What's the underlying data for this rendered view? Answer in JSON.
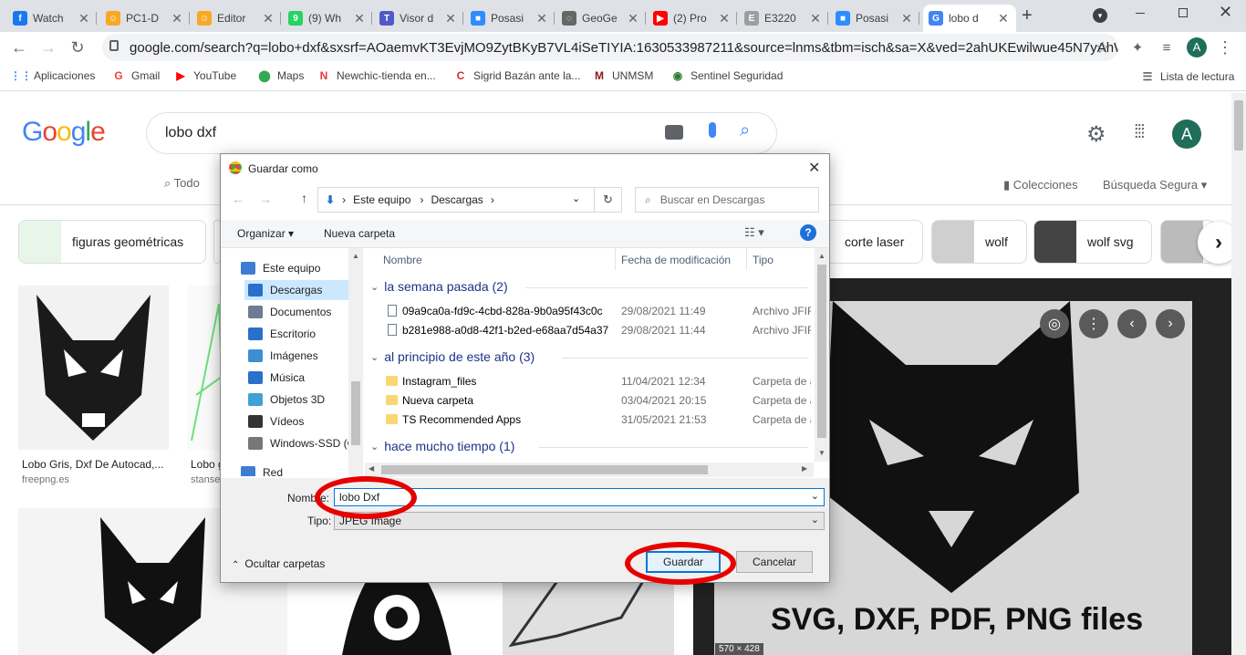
{
  "browser": {
    "tabs": [
      {
        "title": "Watch",
        "favicon": "facebook-icon",
        "color": "#1877f2",
        "glyph": "f"
      },
      {
        "title": "PC1-D",
        "favicon": "emoji-icon",
        "color": "#f9a825",
        "glyph": "☺"
      },
      {
        "title": "Editor",
        "favicon": "emoji-icon",
        "color": "#f9a825",
        "glyph": "☺"
      },
      {
        "title": "(9) Wh",
        "favicon": "whatsapp-icon",
        "color": "#25d366",
        "glyph": "9"
      },
      {
        "title": "Visor d",
        "favicon": "teams-icon",
        "color": "#5059c9",
        "glyph": "T"
      },
      {
        "title": "Posasi",
        "favicon": "zoom-icon",
        "color": "#2d8cff",
        "glyph": "■"
      },
      {
        "title": "GeoGe",
        "favicon": "geogebra-icon",
        "color": "#666666",
        "glyph": "◌"
      },
      {
        "title": "(2) Pro",
        "favicon": "youtube-icon",
        "color": "#ff0000",
        "glyph": "▶"
      },
      {
        "title": "E3220",
        "favicon": "document-icon",
        "color": "#9e9e9e",
        "glyph": "E"
      },
      {
        "title": "Posasi",
        "favicon": "zoom-icon",
        "color": "#2d8cff",
        "glyph": "■"
      },
      {
        "title": "lobo d",
        "favicon": "google-icon",
        "color": "#4285f4",
        "glyph": "G"
      }
    ],
    "url": "google.com/search?q=lobo+dxf&sxsrf=AOaemvKT3EvjMO9ZytBKyB7VL4iSeTIYIA:1630533987211&source=lnms&tbm=isch&sa=X&ved=2ahUKEwilwue45N7yAhWzr5...",
    "profile_initial": "A",
    "bookmarks": [
      {
        "label": "Aplicaciones",
        "icon": "apps-grid-icon",
        "color": "#4285f4",
        "glyph": "⋮⋮"
      },
      {
        "label": "Gmail",
        "icon": "google-icon",
        "color": "#ea4335",
        "glyph": "G"
      },
      {
        "label": "YouTube",
        "icon": "youtube-icon",
        "color": "#ff0000",
        "glyph": "▶"
      },
      {
        "label": "Maps",
        "icon": "maps-pin-icon",
        "color": "#34a853",
        "glyph": "⬤"
      },
      {
        "label": "Newchic-tienda en...",
        "icon": "newchic-icon",
        "color": "#e53935",
        "glyph": "N"
      },
      {
        "label": "Sigrid Bazán ante la...",
        "icon": "c-logo-icon",
        "color": "#d32f2f",
        "glyph": "C"
      },
      {
        "label": "UNMSM",
        "icon": "unmsm-icon",
        "color": "#8b1a1a",
        "glyph": "M"
      },
      {
        "label": "Sentinel Seguridad",
        "icon": "eye-icon",
        "color": "#2e7d32",
        "glyph": "◉"
      }
    ],
    "reading_list": "Lista de lectura"
  },
  "google": {
    "logo": "Google",
    "query": "lobo dxf",
    "profile_initial": "A",
    "tabs": {
      "all": "Todo"
    },
    "collections": "Colecciones",
    "safe_search": "Búsqueda Segura",
    "chips": [
      "figuras geométricas",
      "corte laser",
      "wolf",
      "wolf svg"
    ],
    "results": [
      {
        "caption": "Lobo Gris, Dxf De Autocad,...",
        "source": "freepng.es"
      },
      {
        "caption": "Lobo g",
        "source": "stanse"
      }
    ],
    "preview": {
      "text": "SVG, DXF, PDF, PNG files",
      "size": "570 × 428"
    }
  },
  "dialog": {
    "title": "Guardar como",
    "path": [
      "Este equipo",
      "Descargas"
    ],
    "search_placeholder": "Buscar en Descargas",
    "organize": "Organizar",
    "new_folder": "Nueva carpeta",
    "nav_items": [
      {
        "label": "Este equipo",
        "icon": "computer-icon"
      },
      {
        "label": "Descargas",
        "icon": "downloads-icon"
      },
      {
        "label": "Documentos",
        "icon": "documents-icon"
      },
      {
        "label": "Escritorio",
        "icon": "desktop-icon"
      },
      {
        "label": "Imágenes",
        "icon": "pictures-icon"
      },
      {
        "label": "Música",
        "icon": "music-icon"
      },
      {
        "label": "Objetos 3D",
        "icon": "objects-3d-icon"
      },
      {
        "label": "Vídeos",
        "icon": "videos-icon"
      },
      {
        "label": "Windows-SSD (C",
        "icon": "drive-icon"
      },
      {
        "label": "Red",
        "icon": "network-icon"
      }
    ],
    "columns": {
      "name": "Nombre",
      "date": "Fecha de modificación",
      "type": "Tipo"
    },
    "groups": [
      {
        "label": "la semana pasada (2)",
        "files": [
          {
            "name": "09a9ca0a-fd9c-4cbd-828a-9b0a95f43c0c",
            "date": "29/08/2021 11:49",
            "type": "Archivo JFIF",
            "kind": "file"
          },
          {
            "name": "b281e988-a0d8-42f1-b2ed-e68aa7d54a37",
            "date": "29/08/2021 11:44",
            "type": "Archivo JFIF",
            "kind": "file"
          }
        ]
      },
      {
        "label": "al principio de este año (3)",
        "files": [
          {
            "name": "Instagram_files",
            "date": "11/04/2021 12:34",
            "type": "Carpeta de ar",
            "kind": "folder"
          },
          {
            "name": "Nueva carpeta",
            "date": "03/04/2021 20:15",
            "type": "Carpeta de ar",
            "kind": "folder"
          },
          {
            "name": "TS Recommended Apps",
            "date": "31/05/2021 21:53",
            "type": "Carpeta de ar",
            "kind": "folder"
          }
        ]
      },
      {
        "label": "hace mucho tiempo (1)",
        "files": []
      }
    ],
    "filename_label": "Nombre:",
    "filename_value": "lobo Dxf",
    "type_label": "Tipo:",
    "type_value": "JPEG Image",
    "hide_folders": "Ocultar carpetas",
    "save": "Guardar",
    "cancel": "Cancelar"
  }
}
